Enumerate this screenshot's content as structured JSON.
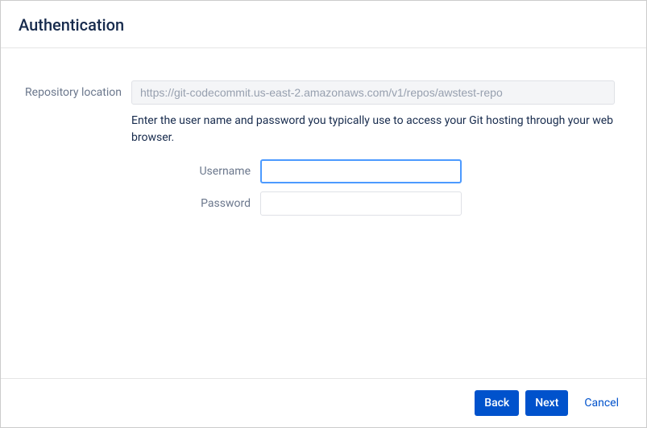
{
  "header": {
    "title": "Authentication"
  },
  "form": {
    "repo_label": "Repository location",
    "repo_value": "https://git-codecommit.us-east-2.amazonaws.com/v1/repos/awstest-repo",
    "help_text": "Enter the user name and password you typically use to access your Git hosting through your web browser.",
    "username_label": "Username",
    "username_value": "",
    "password_label": "Password",
    "password_value": ""
  },
  "footer": {
    "back_label": "Back",
    "next_label": "Next",
    "cancel_label": "Cancel"
  }
}
